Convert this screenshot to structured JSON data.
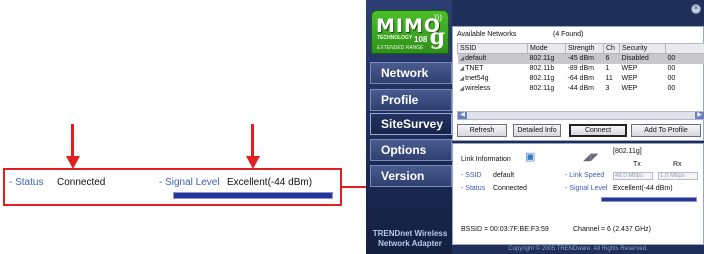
{
  "zoom": {
    "status_label": "- Status",
    "status_value": "Connected",
    "signal_label": "- Signal Level",
    "signal_value": "Excellent(-44 dBm)"
  },
  "app": {
    "logo_main": "MIMO",
    "logo_technology": "TECHNOLOGY",
    "logo_num": "108",
    "logo_g": "g",
    "logo_range": "EXTENDED RANGE",
    "nav": [
      "Network",
      "Profile",
      "SiteSurvey",
      "Options",
      "Version"
    ],
    "active_nav": "SiteSurvey",
    "brand_line1": "TRENDnet Wireless",
    "brand_line2": "Network Adapter",
    "close_glyph": "×"
  },
  "networks": {
    "heading": "Available Networks",
    "found": "(4 Found)",
    "columns": [
      "SSID",
      "Mode",
      "Strength",
      "Ch",
      "Security",
      ""
    ],
    "rows": [
      {
        "ssid": "default",
        "mode": "802.11g",
        "strength": "-45 dBm",
        "ch": "6",
        "security": "Disabled",
        "extra": "00"
      },
      {
        "ssid": "TNET",
        "mode": "802.11b",
        "strength": "-89 dBm",
        "ch": "1",
        "security": "WEP",
        "extra": "00"
      },
      {
        "ssid": "tnet54g",
        "mode": "802.11g",
        "strength": "-64 dBm",
        "ch": "11",
        "security": "WEP",
        "extra": "00"
      },
      {
        "ssid": "wireless",
        "mode": "802.11g",
        "strength": "-44 dBm",
        "ch": "3",
        "security": "WEP",
        "extra": "00"
      }
    ],
    "buttons": [
      "Refresh",
      "Detailed Info",
      "Connect",
      "Add To Profile"
    ]
  },
  "link": {
    "section_label": "Link Information",
    "mode_tag": "[802.11g]",
    "tx_label": "Tx",
    "rx_label": "Rx",
    "ssid_label": "- SSID",
    "ssid_value": "default",
    "status_label": "- Status",
    "status_value": "Connected",
    "speed_label": "- Link Speed",
    "tx_speed": "48.0 Mbps",
    "rx_speed": "1.0 Mbps",
    "signal_label": "- Signal Level",
    "signal_value": "Excellent(-44 dBm)",
    "bssid": "BSSID = 00:03:7F:BE:F3:59",
    "channel": "Channel = 6 (2.437 GHz)"
  },
  "footer": "Copyright © 2005 TRENDware. All Rights Reserved."
}
